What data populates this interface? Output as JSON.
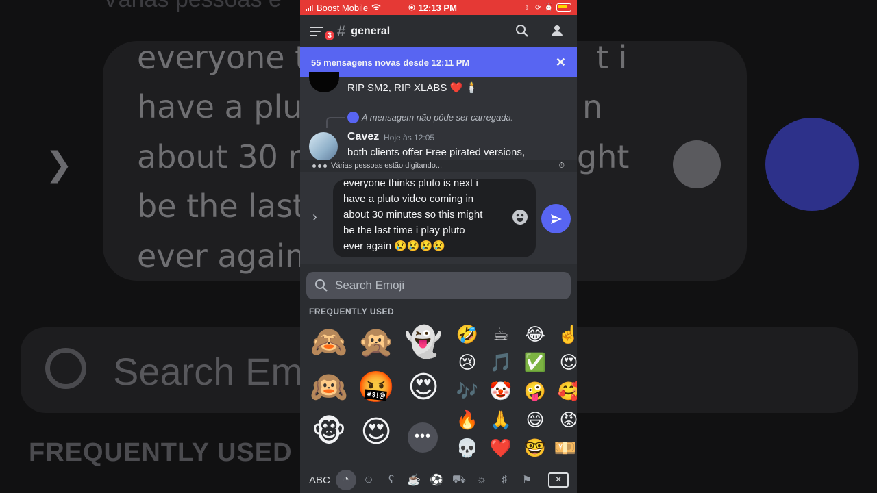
{
  "background": {
    "top_text": "Várias pessoas e",
    "lines": [
      "everyone t",
      "have a plut",
      "about 30 r",
      "be the last",
      "ever again"
    ],
    "right_fragments": [
      "t i",
      "n",
      "ght",
      "",
      ""
    ],
    "search_text": "Search Em",
    "freq_text": "FREQUENTLY USED"
  },
  "statusbar": {
    "carrier": "Boost Mobile",
    "time": "12:13 PM"
  },
  "header": {
    "badge": "3",
    "hash": "#",
    "channel": "general"
  },
  "banner": {
    "text": "55 mensagens novas desde 12:11 PM",
    "close": "✕"
  },
  "messages": {
    "first_text": "RIP SM2, RIP XLABS ❤️ 🕯️",
    "reply_text": "A mensagem não pôde ser carregada.",
    "author": "Cavez",
    "timestamp": "Hoje às 12:05",
    "second_text": "both clients offer Free pirated versions,",
    "typing": "Várias pessoas estão digitando..."
  },
  "composer": {
    "text": "everyone thinks pluto is next i\nhave a pluto video coming in\nabout 30 minutes so this might\nbe the last time i play pluto\never again 😢😢😢😢"
  },
  "emoji_panel": {
    "search_placeholder": "Search Emoji",
    "section": "FREQUENTLY USED",
    "big_emojis": [
      "🙈",
      "🙊",
      "👻",
      "🙉",
      "🤬",
      "😍",
      "🐵",
      "😍"
    ],
    "small_emojis": [
      "🤣",
      "☕",
      "😂",
      "☝️",
      "😢",
      "🎵",
      "✅",
      "😍",
      "🎶",
      "🤡",
      "🤪",
      "🥰",
      "🔥",
      "🙏",
      "😄",
      "😡",
      "💀",
      "❤️",
      "🤓",
      "💴"
    ],
    "more": "•••",
    "abc": "ABC",
    "tab_icons": [
      "clock-icon",
      "smile-icon",
      "animal-icon",
      "food-icon",
      "ball-icon",
      "car-icon",
      "bulb-icon",
      "symbols-icon",
      "flag-icon"
    ]
  },
  "colors": {
    "accent": "#5865f2",
    "statusbar": "#e53935",
    "bg": "#313338"
  }
}
